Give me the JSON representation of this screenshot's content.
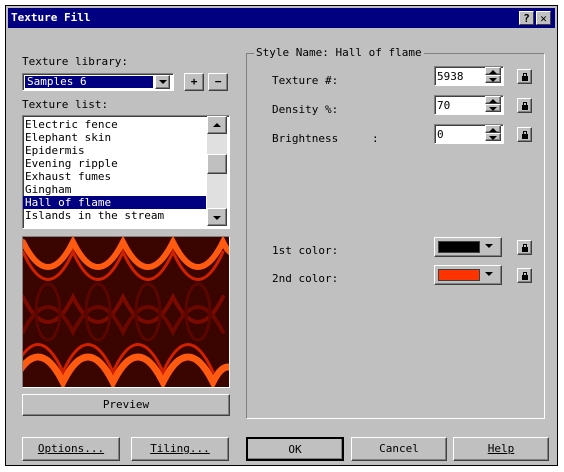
{
  "window": {
    "title": "Texture Fill",
    "help_label": "?",
    "close_label": "✕"
  },
  "library": {
    "label": "Texture library:",
    "selected": "Samples 6",
    "add_label": "+",
    "remove_label": "−"
  },
  "texture_list": {
    "label": "Texture list:",
    "items": [
      "Electric fence",
      "Elephant skin",
      "Epidermis",
      "Evening ripple",
      "Exhaust fumes",
      "Gingham",
      "Hall of flame",
      "Islands in the stream"
    ],
    "selected_index": 6
  },
  "preview_button": "Preview",
  "style": {
    "name_label": "Style Name: Hall of flame",
    "texture_label": "Texture #:",
    "texture_value": "5938",
    "density_label": "Density %:",
    "density_value": "70",
    "brightness_label": "Brightness",
    "brightness_colon": ":",
    "brightness_value": "0",
    "color1_label": "1st color:",
    "color1": "#000000",
    "color2_label": "2nd color:",
    "color2": "#ff3300"
  },
  "buttons": {
    "options": "Options...",
    "tiling": "Tiling...",
    "ok": "OK",
    "cancel": "Cancel",
    "help": "Help"
  }
}
